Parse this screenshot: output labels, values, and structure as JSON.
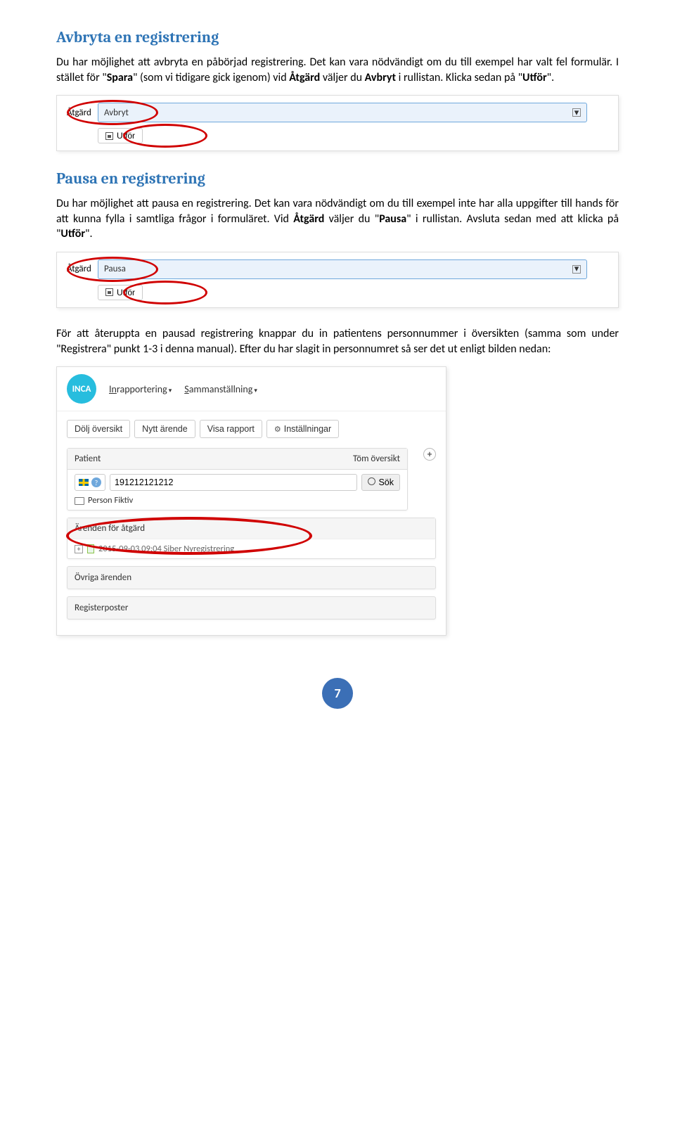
{
  "section1": {
    "heading": "Avbryta en registrering",
    "para_parts": [
      "Du har möjlighet att avbryta en påbörjad registrering. Det kan vara nödvändigt om du till exempel har valt fel formulär. I stället för \"",
      "Spara",
      "\" (som vi tidigare gick igenom) vid ",
      "Åtgärd",
      " väljer du ",
      "Avbryt",
      " i rullistan. Klicka sedan på \"",
      "Utför",
      "\"."
    ],
    "dropdown_label": "Åtgärd",
    "dropdown_value": "Avbryt",
    "button_label": "Utför"
  },
  "section2": {
    "heading": "Pausa en registrering",
    "para_parts": [
      "Du har möjlighet att pausa en registrering. Det kan vara nödvändigt om du till exempel inte har alla uppgifter till hands för att kunna fylla i samtliga frågor i formuläret. Vid ",
      "Åtgärd",
      " väljer du \"",
      "Pausa",
      "\" i rullistan. Avsluta sedan med att klicka på \"",
      "Utför",
      "\"."
    ],
    "dropdown_label": "Åtgärd",
    "dropdown_value": "Pausa",
    "button_label": "Utför"
  },
  "section3": {
    "para": "För att återuppta en pausad registrering knappar du in patientens personnummer i översikten (samma som under \"Registrera\" punkt 1-3 i denna manual). Efter du har slagit in personnumret så ser det ut enligt bilden nedan:"
  },
  "inca": {
    "logo": "INCA",
    "nav1": "Inrapportering",
    "nav2": "Sammanställning",
    "buttons": {
      "b1": "Dölj översikt",
      "b2": "Nytt ärende",
      "b3": "Visa rapport",
      "b4": "Inställningar"
    },
    "patient_panel": {
      "title": "Patient",
      "clear": "Töm översikt",
      "personnummer": "191212121212",
      "sok": "Sök",
      "person_name": "Person Fiktiv"
    },
    "arenden": {
      "title": "Ärenden för åtgärd",
      "item": "2015-09-03 09:04 Siber Nyregistrering"
    },
    "ovriga": "Övriga ärenden",
    "register": "Registerposter"
  },
  "page_number": "7"
}
